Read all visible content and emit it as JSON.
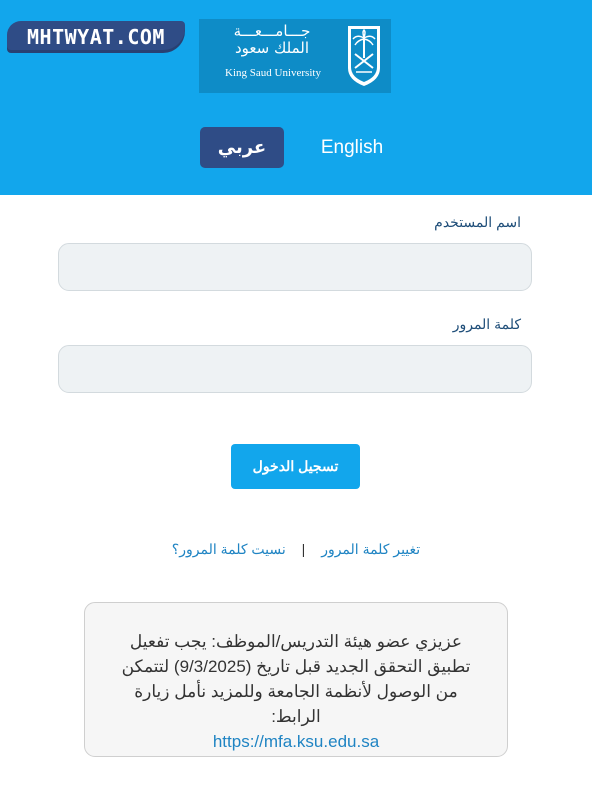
{
  "watermark": {
    "text": "MHTWYAT.COM"
  },
  "logo": {
    "arabic_line1": "جـــامـــعـــة",
    "arabic_line2": "الملك سعود",
    "english": "King Saud University",
    "emblem": "palm-swords-emblem"
  },
  "language": {
    "arabic_label": "عربي",
    "english_label": "English",
    "active": "arabic"
  },
  "form": {
    "username_label": "اسم المستخدم",
    "username_value": "",
    "password_label": "كلمة المرور",
    "password_value": "",
    "login_label": "تسجيل الدخول"
  },
  "links": {
    "change_password": "تغيير كلمة المرور",
    "separator": "|",
    "forgot_password": "نسيت كلمة المرور؟"
  },
  "notice": {
    "text": "عزيزي عضو هيئة التدريس/الموظف: يجب تفعيل تطبيق التحقق الجديد قبل تاريخ (9/3/2025) لتتمكن من الوصول لأنظمة الجامعة وللمزيد نأمل زيارة الرابط:",
    "link": "https://mfa.ksu.edu.sa"
  },
  "colors": {
    "header_bg": "#12a6ec",
    "dark_blue": "#2f4c86",
    "link": "#1f84c3",
    "label": "#1f4e79"
  }
}
